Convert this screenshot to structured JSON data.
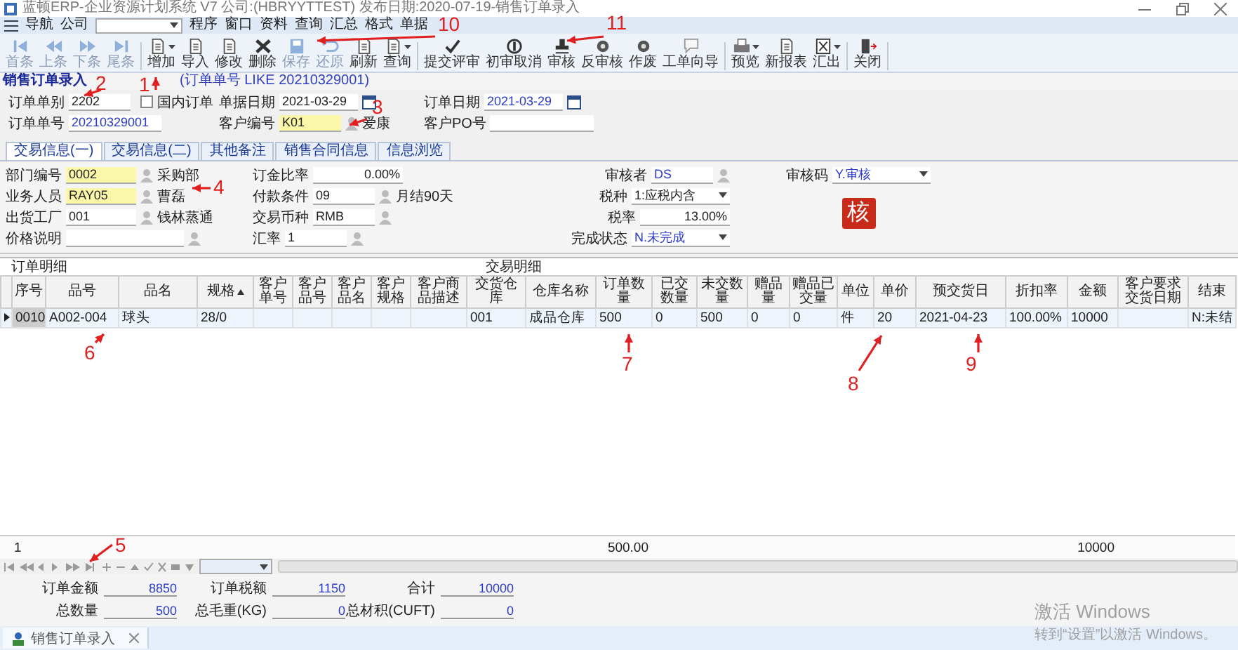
{
  "window": {
    "title": "蓝顿ERP-企业资源计划系统 V7 公司:(HBRYYTTEST) 发布日期:2020-07-19-销售订单录入"
  },
  "menu": {
    "nav": "导航",
    "company_label": "公司",
    "items": [
      "程序",
      "窗口",
      "资料",
      "查询",
      "汇总",
      "格式",
      "单据"
    ]
  },
  "toolbar_groups": [
    {
      "buttons": [
        {
          "label": "首条",
          "disabled": true,
          "has_menu": false
        },
        {
          "label": "上条",
          "disabled": true,
          "has_menu": false
        },
        {
          "label": "下条",
          "disabled": true,
          "has_menu": false
        },
        {
          "label": "尾条",
          "disabled": true,
          "has_menu": false
        }
      ]
    },
    {
      "buttons": [
        {
          "label": "增加",
          "disabled": false,
          "has_menu": true
        },
        {
          "label": "导入",
          "disabled": false,
          "has_menu": false
        },
        {
          "label": "修改",
          "disabled": false,
          "has_menu": false
        },
        {
          "label": "删除",
          "disabled": false,
          "has_menu": false
        },
        {
          "label": "保存",
          "disabled": true,
          "has_menu": false
        },
        {
          "label": "还原",
          "disabled": true,
          "has_menu": false
        },
        {
          "label": "刷新",
          "disabled": false,
          "has_menu": false
        },
        {
          "label": "查询",
          "disabled": false,
          "has_menu": true
        }
      ]
    },
    {
      "buttons": [
        {
          "label": "提交评审",
          "disabled": false,
          "has_menu": false
        },
        {
          "label": "初审取消",
          "disabled": false,
          "has_menu": false
        },
        {
          "label": "审核",
          "disabled": false,
          "has_menu": false
        },
        {
          "label": "反审核",
          "disabled": false,
          "has_menu": false
        },
        {
          "label": "作废",
          "disabled": false,
          "has_menu": false
        },
        {
          "label": "工单向导",
          "disabled": false,
          "has_menu": false
        }
      ]
    },
    {
      "buttons": [
        {
          "label": "预览",
          "disabled": false,
          "has_menu": true
        },
        {
          "label": "新报表",
          "disabled": false,
          "has_menu": false
        },
        {
          "label": "汇出",
          "disabled": false,
          "has_menu": true
        }
      ]
    },
    {
      "buttons": [
        {
          "label": "关闭",
          "disabled": false,
          "has_menu": false
        }
      ]
    }
  ],
  "form": {
    "title": "销售订单录入",
    "query": "(订单单号 LIKE 20210329001)"
  },
  "header": {
    "rows": [
      [
        [
          {
            "kind": "text",
            "label": "订单单别",
            "value": "2202",
            "required": false,
            "readonly": false
          },
          {
            "kind": "check",
            "label": "国内订单",
            "checked": false
          }
        ],
        [
          {
            "kind": "date",
            "label": "单据日期",
            "value": "2021-03-29",
            "required": false,
            "readonly": false
          }
        ],
        [
          {
            "kind": "date",
            "label": "订单日期",
            "value": "2021-03-29",
            "required": false,
            "readonly": true
          }
        ]
      ],
      [
        [
          {
            "kind": "text",
            "label": "订单单号",
            "value": "20210329001",
            "required": false,
            "readonly": true
          }
        ],
        [
          {
            "kind": "lookup",
            "label": "客户编号",
            "value": "K01",
            "name": "爱康",
            "required": true,
            "readonly": false
          }
        ],
        [
          {
            "kind": "text",
            "label": "客户PO号",
            "required": false
          }
        ]
      ]
    ]
  },
  "tabs": [
    {
      "label": "交易信息(一)",
      "selected": true
    },
    {
      "label": "交易信息(二)",
      "selected": false
    },
    {
      "label": "其他备注",
      "selected": false
    },
    {
      "label": "销售合同信息",
      "selected": false
    },
    {
      "label": "信息浏览",
      "selected": false
    }
  ],
  "trade_info": {
    "columns": [
      [
        {
          "kind": "lookup",
          "label": "部门编号",
          "value": "0002",
          "name": "采购部",
          "required": true,
          "readonly": false
        },
        {
          "kind": "lookup",
          "label": "业务人员",
          "value": "RAY05",
          "name": "曹磊",
          "required": true,
          "readonly": false
        },
        {
          "kind": "lookup",
          "label": "出货工厂",
          "value": "001",
          "name": "钱林蒸通",
          "required": false,
          "readonly": false
        },
        {
          "kind": "lookup",
          "label": "价格说明",
          "required": false
        }
      ],
      [
        {
          "kind": "number",
          "label": "订金比率",
          "value": "0.00%",
          "required": false,
          "readonly": false
        },
        {
          "kind": "lookup",
          "label": "付款条件",
          "value": "09",
          "name": "月结90天",
          "required": false,
          "readonly": false
        },
        {
          "kind": "lookup",
          "label": "交易币种",
          "value": "RMB",
          "required": false,
          "readonly": false
        },
        {
          "kind": "lookup",
          "label": "汇率",
          "value": "1",
          "required": false,
          "readonly": false
        }
      ],
      [
        {
          "kind": "lookup",
          "label": "审核者",
          "value": "DS",
          "required": false,
          "readonly": true
        },
        {
          "kind": "dropdown",
          "label": "税种",
          "value": "1:应税内含",
          "readonly": false
        },
        {
          "kind": "number",
          "label": "税率",
          "value": "13.00%",
          "required": false,
          "readonly": false
        },
        {
          "kind": "dropdown",
          "label": "完成状态",
          "value": "N.未完成",
          "readonly": true
        }
      ],
      [
        {
          "kind": "dropdown",
          "label": "审核码",
          "value": "Y.审核",
          "readonly": true
        }
      ]
    ],
    "stamp": "核"
  },
  "grid": {
    "title": "订单明细",
    "section": "交易明细",
    "columns": [
      {
        "label": "序号",
        "sorted": false
      },
      {
        "label": "品号",
        "sorted": false
      },
      {
        "label": "品名",
        "sorted": false
      },
      {
        "label": "规格",
        "sorted": true
      },
      {
        "label": "客户单号",
        "sorted": false
      },
      {
        "label": "客户品号",
        "sorted": false
      },
      {
        "label": "客户品名",
        "sorted": false
      },
      {
        "label": "客户规格",
        "sorted": false
      },
      {
        "label": "客户商品描述",
        "sorted": false
      },
      {
        "label": "交货仓库",
        "sorted": false
      },
      {
        "label": "仓库名称",
        "sorted": false
      },
      {
        "label": "订单数量",
        "sorted": false
      },
      {
        "label": "已交数量",
        "sorted": false
      },
      {
        "label": "未交数量",
        "sorted": false
      },
      {
        "label": "赠品量",
        "sorted": false
      },
      {
        "label": "赠品已交量",
        "sorted": false
      },
      {
        "label": "单位",
        "sorted": false
      },
      {
        "label": "单价",
        "sorted": false
      },
      {
        "label": "预交货日",
        "sorted": false
      },
      {
        "label": "折扣率",
        "sorted": false
      },
      {
        "label": "金额",
        "sorted": false
      },
      {
        "label": "客户要求交货日期",
        "sorted": false
      },
      {
        "label": "结束",
        "sorted": false
      }
    ],
    "rows": [
      {
        "selected": true,
        "cells": [
          "0010",
          "A002-004",
          "球头",
          "28/0",
          "",
          "",
          "",
          "",
          "",
          "001",
          "成品仓库",
          "500",
          "0",
          "500",
          "0",
          "0",
          "件",
          "20",
          "2021-04-23",
          "100.00%",
          "10000",
          "",
          "N:未结"
        ]
      }
    ],
    "summary": {
      "count": "1",
      "quantity": "500.00",
      "amount": "10000"
    }
  },
  "totals": [
    {
      "label": "订单金额",
      "value": "8850"
    },
    {
      "label": "订单税额",
      "value": "1150"
    },
    {
      "label": "合计",
      "value": "10000"
    },
    {
      "label": "总数量",
      "value": "500"
    },
    {
      "label": "总毛重(KG)",
      "value": "0"
    },
    {
      "label": "总材积(CUFT)",
      "value": "0"
    }
  ],
  "bottom_tabs": [
    {
      "label": "销售订单录入",
      "selected": true
    }
  ],
  "os_notice": {
    "title": "激活 Windows",
    "text": "转到“设置”以激活 Windows。"
  },
  "annotations": [
    {
      "label": "1"
    },
    {
      "label": "2"
    },
    {
      "label": "3"
    },
    {
      "label": "4"
    },
    {
      "label": "5"
    },
    {
      "label": "6"
    },
    {
      "label": "7"
    },
    {
      "label": "8"
    },
    {
      "label": "9"
    },
    {
      "label": "10"
    },
    {
      "label": "11"
    }
  ]
}
